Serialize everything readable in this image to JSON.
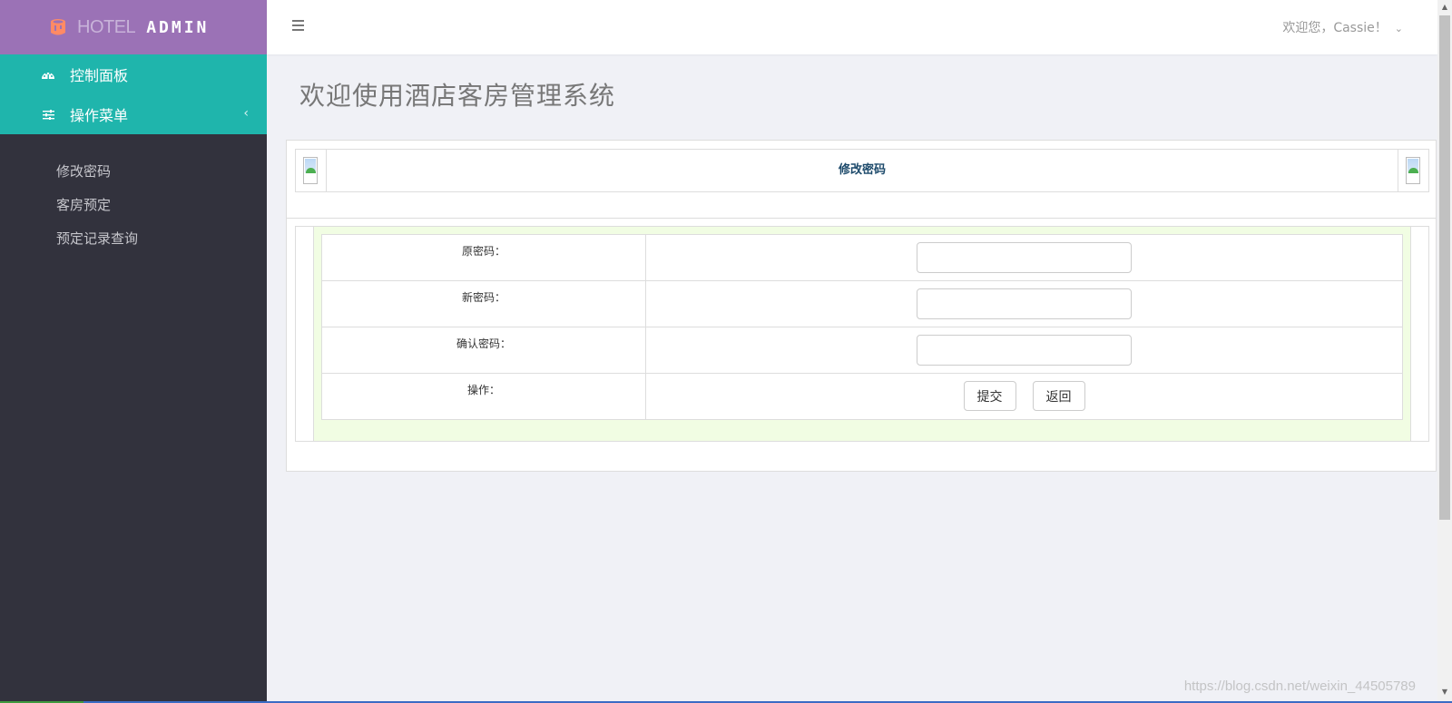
{
  "brand": {
    "hotel": "HOTEL",
    "admin": "ADMIN",
    "logo_icon": "paint-bucket-icon",
    "logo_color": "#ff8a65"
  },
  "colors": {
    "brand_bg": "#9b72b6",
    "nav_active_bg": "#1fb5ac",
    "sidebar_bg": "#32323d",
    "form_bg": "#f1fde3",
    "header_title": "#1d4a6b"
  },
  "sidebar": {
    "top_items": [
      {
        "label": "控制面板",
        "icon": "dashboard-icon"
      },
      {
        "label": "操作菜单",
        "icon": "sliders-icon",
        "chevron": "‹"
      }
    ],
    "sub_items": [
      {
        "label": "修改密码"
      },
      {
        "label": "客房预定"
      },
      {
        "label": "预定记录查询"
      }
    ]
  },
  "topbar": {
    "menu_icon": "hamburger-icon",
    "user_greeting": "欢迎您，Cassie！",
    "user_caret": "⌄"
  },
  "main": {
    "page_title": "欢迎使用酒店客房管理系统",
    "panel_title": "修改密码",
    "form": {
      "rows": [
        {
          "label": "原密码：",
          "value": ""
        },
        {
          "label": "新密码：",
          "value": ""
        },
        {
          "label": "确认密码：",
          "value": ""
        }
      ],
      "action_label": "操作：",
      "submit": "提交",
      "back": "返回"
    }
  },
  "watermark": "https://blog.csdn.net/weixin_44505789"
}
